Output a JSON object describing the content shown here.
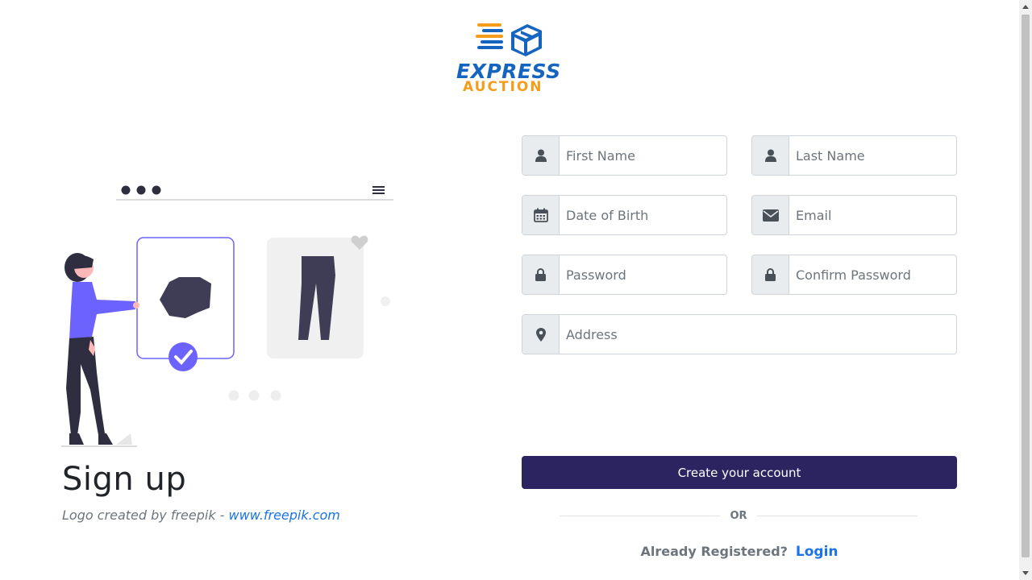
{
  "logo": {
    "line1": "EXPRESS",
    "line2": "AUCTION"
  },
  "signup_title": "Sign up",
  "credit": {
    "prefix": "Logo created by freepik - ",
    "link": "www.freepik.com"
  },
  "form": {
    "first_name": {
      "placeholder": "First Name",
      "icon": "user-icon"
    },
    "last_name": {
      "placeholder": "Last Name",
      "icon": "user-icon"
    },
    "dob": {
      "placeholder": "Date of Birth",
      "icon": "calendar-icon"
    },
    "email": {
      "placeholder": "Email",
      "icon": "envelope-icon"
    },
    "password": {
      "placeholder": "Password",
      "icon": "lock-icon"
    },
    "confirm_password": {
      "placeholder": "Confirm Password",
      "icon": "lock-icon"
    },
    "address": {
      "placeholder": "Address",
      "icon": "map-marker-icon"
    },
    "submit_label": "Create your account"
  },
  "divider": "OR",
  "footer": {
    "question": "Already Registered?",
    "login_label": "Login"
  },
  "colors": {
    "primary_button": "#2c2461",
    "link": "#1a73e8",
    "accent": "#6c63ff",
    "logo_blue": "#1565c0",
    "logo_orange": "#f59c1a"
  }
}
